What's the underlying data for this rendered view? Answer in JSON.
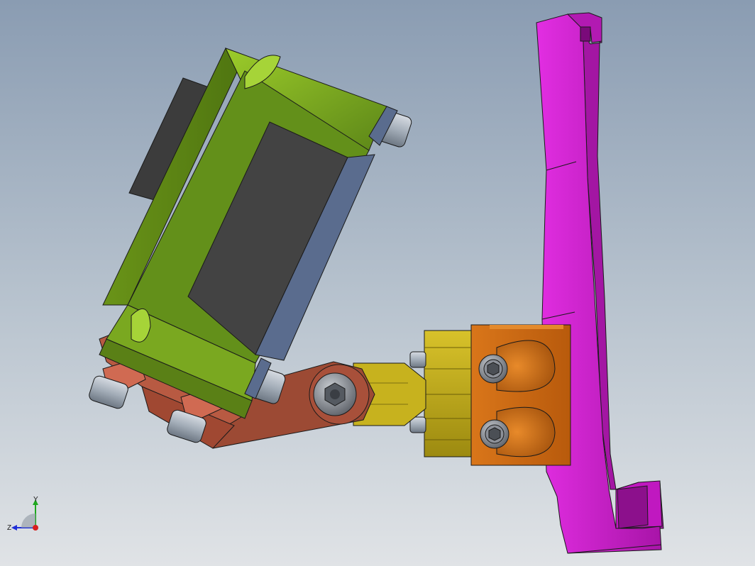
{
  "viewport": {
    "background_top": "#8a9cb2",
    "background_bottom": "#e0e3e6"
  },
  "parts": {
    "sensor_body_color": "#6e9a1c",
    "sensor_face_color": "#434343",
    "sensor_side_color": "#5a6c8e",
    "mount_bracket_color": "#a8503a",
    "connector_color": "#c8b020",
    "clamp_block_color": "#c86a12",
    "hook_bracket_color": "#c81ec8"
  },
  "triad": {
    "y_label": "Y",
    "z_label": "Z",
    "y_color": "#1fa81f",
    "z_color": "#1f2fd8",
    "x_color": "#d81f1f"
  }
}
